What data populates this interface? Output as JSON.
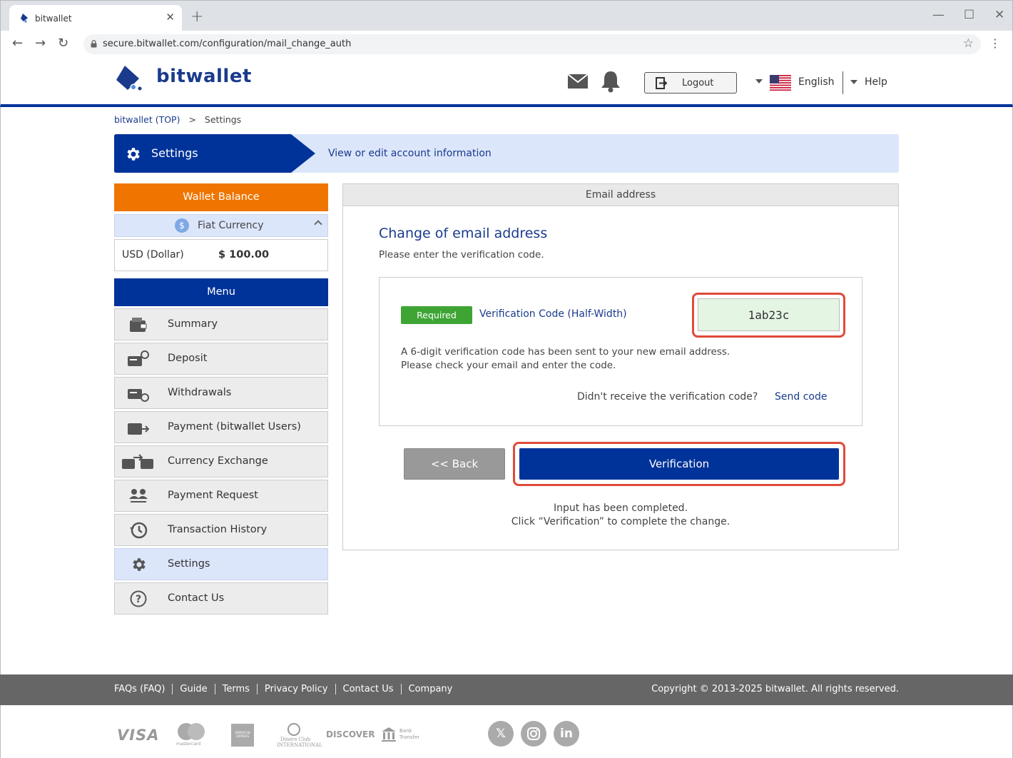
{
  "browser": {
    "tab_title": "bitwallet",
    "tab_close": "✕",
    "new_tab": "+",
    "url": "secure.bitwallet.com/configuration/mail_change_auth"
  },
  "header": {
    "logo_text": "bitwallet",
    "logout_label": "Logout",
    "language_label": "English",
    "help_label": "Help"
  },
  "breadcrumb": {
    "home": "bitwallet (TOP)",
    "separator": ">",
    "current": "Settings"
  },
  "banner": {
    "title": "Settings",
    "description": "View or edit account information"
  },
  "sidebar": {
    "wallet_balance_title": "Wallet Balance",
    "fiat_label": "Fiat Currency",
    "fiat_symbol": "$",
    "balance_currency": "USD (Dollar)",
    "balance_amount": "$ 100.00",
    "menu_title": "Menu",
    "menu_items": [
      {
        "label": "Summary",
        "icon": "wallet-icon"
      },
      {
        "label": "Deposit",
        "icon": "deposit-icon"
      },
      {
        "label": "Withdrawals",
        "icon": "withdrawal-icon"
      },
      {
        "label": "Payment (bitwallet Users)",
        "icon": "payment-icon"
      },
      {
        "label": "Currency Exchange",
        "icon": "exchange-icon"
      },
      {
        "label": "Payment Request",
        "icon": "users-icon"
      },
      {
        "label": "Transaction History",
        "icon": "history-icon"
      },
      {
        "label": "Settings",
        "icon": "gear-icon",
        "active": true
      },
      {
        "label": "Contact Us",
        "icon": "question-icon"
      }
    ]
  },
  "main": {
    "panel_header": "Email address",
    "title": "Change of email address",
    "subtitle": "Please enter the verification code.",
    "required_badge": "Required",
    "field_label": "Verification Code (Half-Width)",
    "code_value": "1ab23c",
    "note_line1": "A 6-digit verification code has been sent to your new email address.",
    "note_line2": "Please check your email and enter the code.",
    "resend_question": "Didn't receive the verification code?",
    "resend_link": "Send code",
    "back_label": "<< Back",
    "verify_label": "Verification",
    "done_line1": "Input has been completed.",
    "done_line2": "Click “Verification” to complete the change."
  },
  "footer": {
    "links": [
      "FAQs (FAQ)",
      "Guide",
      "Terms",
      "Privacy Policy",
      "Contact Us",
      "Company"
    ],
    "copyright": "Copyright © 2013-2025 bitwallet. All rights reserved.",
    "payment_logos": [
      "VISA",
      "mastercard",
      "AMERICAN EXPRESS",
      "Diners Club INTERNATIONAL",
      "DISCOVER",
      "Bank Transfer"
    ],
    "social": [
      "x-icon",
      "instagram-icon",
      "linkedin-icon"
    ]
  },
  "colors": {
    "brand_blue": "#003399",
    "accent_orange": "#f07500",
    "required_green": "#3ea535",
    "highlight_red": "#e04a3a"
  }
}
